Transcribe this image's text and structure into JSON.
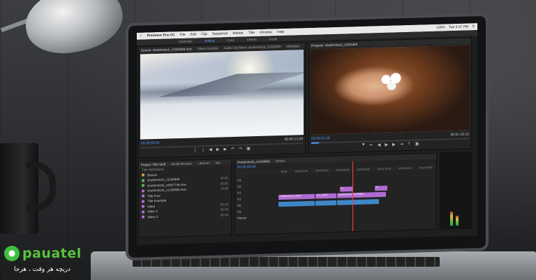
{
  "menubar": {
    "app": "Premiere Pro CC",
    "items": [
      "File",
      "Edit",
      "Clip",
      "Sequence",
      "Marker",
      "Title",
      "Window",
      "Help"
    ],
    "battery": "100%",
    "clock": "Tue 4:37 PM"
  },
  "workspaces": [
    "Assembly",
    "Editing",
    "Color",
    "Effects",
    "Audio"
  ],
  "source_monitor": {
    "tabs": [
      "Source: shutterstock_v1934469.mov",
      "Effect Controls",
      "Audio Clip Mixer: shutterstock_v1903469",
      "Metadata"
    ],
    "timecode_left": "00:00:00:00",
    "timecode_right": "00:00:13:28",
    "playhead_progress": 0.0
  },
  "program_monitor": {
    "tab": "Program: shutterstock_v1903469",
    "timecode_left": "00:00:01:28",
    "timecode_right": "00:01:16:12",
    "zoom": "Fit",
    "quality": "1/4",
    "playhead_progress": 0.05
  },
  "project_panel": {
    "tabs": [
      "Project: Title Stuff",
      "Media Browser",
      "Libraries",
      "Info"
    ],
    "file": "Title Stuff.prproj",
    "items": [
      {
        "name": "Bronze",
        "color": "#c9a14a",
        "duration": ""
      },
      {
        "name": "shutterstock_v1199866",
        "color": "#5ab65a",
        "duration": "10:01"
      },
      {
        "name": "shutterstock_v4967746.mov",
        "color": "#5ab65a",
        "duration": "05:02"
      },
      {
        "name": "shutterstock_v1239965.mov",
        "color": "#b06ad0",
        "duration": "13:28"
      },
      {
        "name": "Title Four",
        "color": "#b06ad0",
        "duration": ""
      },
      {
        "name": "Title Example",
        "color": "#b06ad0",
        "duration": ""
      },
      {
        "name": "Video",
        "color": "#b06ad0",
        "duration": "05:18"
      },
      {
        "name": "Video 2",
        "color": "#b06ad0",
        "duration": "10:16"
      },
      {
        "name": "Video 3",
        "color": "#b06ad0",
        "duration": "05:18"
      }
    ]
  },
  "timeline": {
    "tabs": [
      "shutterstock_v1234969",
      "Dream"
    ],
    "timecode": "00:00:00:00",
    "ruler": [
      "00:00",
      "00:00:15:00",
      "00:00:30:00",
      "00:00:45:00",
      "00:01:00:00",
      "00:01:15:00",
      "00:01:30:00",
      "00:01:45:00"
    ],
    "track_labels": [
      "V3",
      "V2",
      "V1",
      "A1",
      "A2",
      "A3",
      "Master"
    ],
    "video_clips": [
      "shutterstock_v1043",
      "sh_v1039",
      "shutterstock_v1039664"
    ],
    "title_clips": [
      "fx",
      "fx"
    ],
    "playhead_progress": 0.48
  },
  "watermark": {
    "name": "pauatel",
    "tagline": "دریچه هر وقت ، هرجا"
  },
  "colors": {
    "accent_blue": "#4aa0ff",
    "video_clip": "#b06ad0",
    "audio_clip": "#3f86c7",
    "playhead": "#ff3c3c",
    "brand_green": "#58c43e"
  }
}
